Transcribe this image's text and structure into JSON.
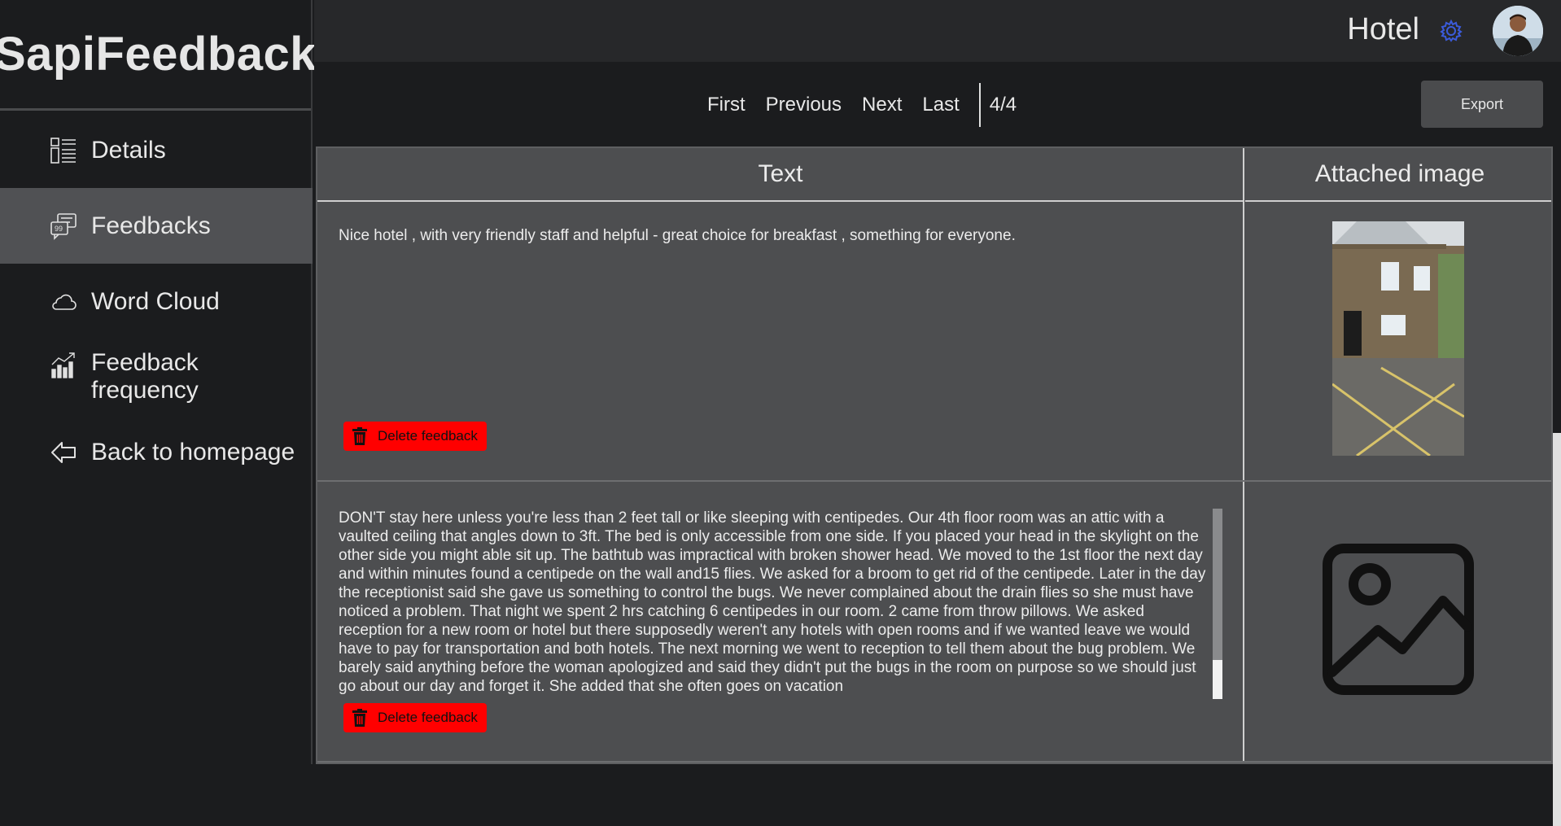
{
  "app": {
    "brand": "SapiFeedback"
  },
  "sidebar": {
    "items": [
      {
        "label": "Details",
        "icon": "details-list-icon",
        "active": false
      },
      {
        "label": "Feedbacks",
        "icon": "feedback-bubbles-icon",
        "active": true
      },
      {
        "label": "Word Cloud",
        "icon": "cloud-icon",
        "active": false
      },
      {
        "label": "Feedback\nfrequency",
        "icon": "bar-chart-icon",
        "active": false
      },
      {
        "label": "Back to homepage",
        "icon": "arrow-left-icon",
        "active": false
      }
    ]
  },
  "header": {
    "hotel_name": "Hotel",
    "settings_icon": "gear-icon",
    "avatar_icon": "user-avatar"
  },
  "pager": {
    "first": "First",
    "previous": "Previous",
    "next": "Next",
    "last": "Last",
    "count": "4/4",
    "export_label": "Export"
  },
  "table": {
    "columns": [
      "Text",
      "Attached image"
    ],
    "rows": [
      {
        "text": "Nice hotel , with very friendly staff and helpful - great choice for breakfast , something for everyone.",
        "delete_label": "Delete feedback",
        "image": "hotel-building-photo"
      },
      {
        "text": "DON'T stay here unless you're less than 2 feet tall or like sleeping with centipedes. Our 4th floor room was an attic with a vaulted ceiling that angles down to 3ft. The bed is only accessible from one side. If you placed your head in the skylight on the other side you might able sit up. The bathtub was impractical with broken shower head. We moved to the 1st floor the next day and within minutes found a centipede on the wall and15 flies. We asked for a broom to get rid of the centipede. Later in the day the receptionist said she gave us something to control the bugs. We never complained about the drain flies so she must have noticed a problem. That night we spent 2 hrs catching 6 centipedes in our room. 2 came from throw pillows. We asked reception for a new room or hotel but there supposedly weren't any hotels with open rooms and if we wanted leave we would have to pay for transportation and both hotels. The next morning we went to reception to tell them about the bug problem. We barely said anything before the woman apologized and said they didn't put the bugs in the room on purpose so we should just go about our day and forget it. She added that she often goes on vacation",
        "delete_label": "Delete feedback",
        "image": "image-placeholder-icon"
      }
    ]
  },
  "colors": {
    "delete": "#ff0000",
    "active_nav": "#505154",
    "accent_gear": "#3b5bdb"
  }
}
